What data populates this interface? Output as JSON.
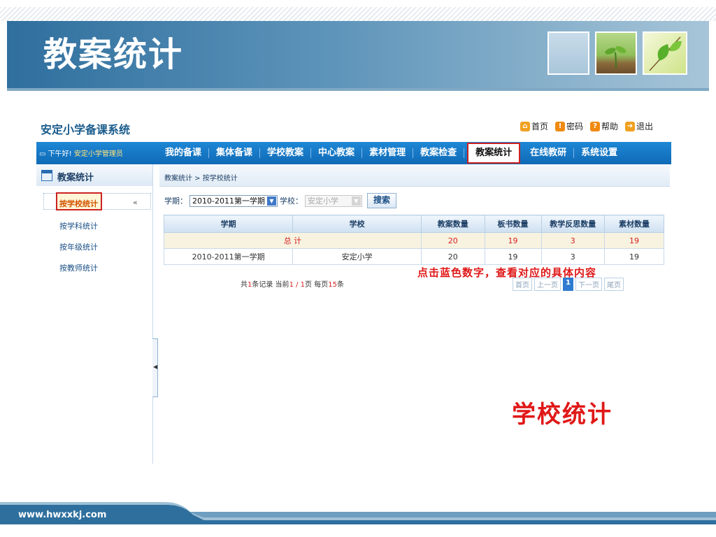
{
  "slide": {
    "title": "教案统计",
    "footer_url": "www.hwxxkj.com"
  },
  "app": {
    "system_title": "安定小学备课系统",
    "top_links": [
      {
        "label": "首页",
        "icon": "home-icon",
        "color": "#f0a020"
      },
      {
        "label": "密码",
        "icon": "key-icon",
        "color": "#f08a10"
      },
      {
        "label": "帮助",
        "icon": "help-icon",
        "color": "#f08a10"
      },
      {
        "label": "退出",
        "icon": "exit-icon",
        "color": "#f0a020"
      }
    ],
    "greeting": "下午好!",
    "user": "安定小学管理员",
    "nav": [
      "我的备课",
      "集体备课",
      "学校教案",
      "中心教案",
      "素材管理",
      "教案检查",
      "教案统计",
      "在线教研",
      "系统设置"
    ],
    "nav_active": "教案统计"
  },
  "sidebar": {
    "header": "教案统计",
    "items": [
      "按学校统计",
      "按学科统计",
      "按年级统计",
      "按教师统计"
    ],
    "selected": "按学校统计",
    "collapse_symbol": "«"
  },
  "content": {
    "breadcrumb": "教案统计 > 按学校统计",
    "filter": {
      "term_label": "学期：",
      "term_value": "2010-2011第一学期",
      "school_label": "学校：",
      "school_value": "安定小学",
      "search_button": "搜索"
    },
    "table": {
      "headers": [
        "学期",
        "学校",
        "教案数量",
        "板书数量",
        "教学反思数量",
        "素材数量"
      ],
      "total_label": "总 计",
      "total_values": [
        "20",
        "19",
        "3",
        "19"
      ],
      "rows": [
        [
          "2010-2011第一学期",
          "安定小学",
          "20",
          "19",
          "3",
          "19"
        ]
      ]
    },
    "page_info": {
      "prefix": "共",
      "count": "1",
      "mid": "条记录 当前",
      "page": "1 / 1",
      "mid2": "页 每页",
      "per_page": "15",
      "suffix": "条"
    },
    "pager": [
      "首页",
      "上一页",
      "1",
      "下一页",
      "尾页"
    ]
  },
  "annotations": {
    "hint": "点击蓝色数字，查看对应的具体内容",
    "label": "学校统计",
    "color": "#e01818"
  }
}
